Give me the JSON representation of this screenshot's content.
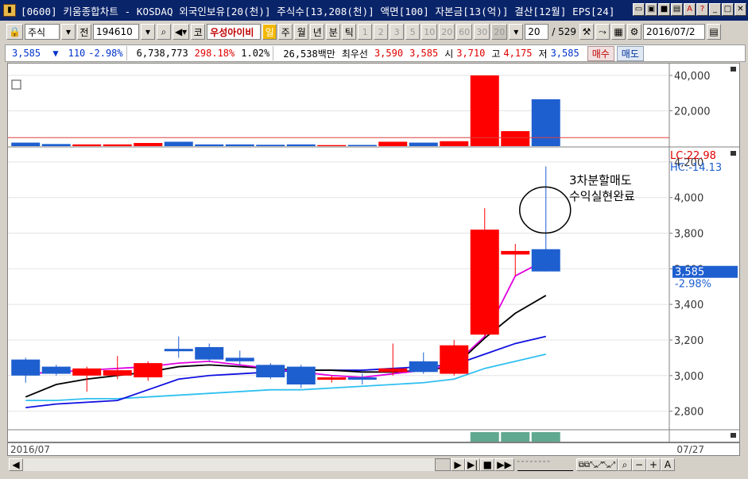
{
  "window": {
    "title": "[0600] 키움종합차트 - KOSDAQ 외국인보유[20(천)] 주식수[13,208(천)] 액면[100] 자본금[13(억)] 결산[12월] EPS[24]"
  },
  "toolbar": {
    "market": "주식",
    "prev": "전",
    "code": "194610",
    "name": "우성아이비",
    "period_buttons": [
      "일",
      "주",
      "월",
      "년",
      "분",
      "틱"
    ],
    "active_period": "일",
    "intervals": [
      "1",
      "2",
      "3",
      "5",
      "10",
      "20",
      "60",
      "30",
      "20"
    ],
    "count": "20",
    "total": "/ 529",
    "date": "2016/07/2"
  },
  "info": {
    "price": "3,585",
    "arrow": "▼",
    "change": "110",
    "change_pct": "-2.98%",
    "volume": "6,738,773",
    "volume_ratio": "298.18%",
    "turnover": "1.02%",
    "amount": "26,538백만",
    "best_ask_label": "최우선",
    "best_ask": "3,590",
    "best_bid": "3,585",
    "open_label": "시",
    "open": "3,710",
    "high_label": "고",
    "high": "4,175",
    "low_label": "저",
    "low": "3,585",
    "buy_label": "매수",
    "sell_label": "매도"
  },
  "volume_axis": [
    "40,000",
    "20,000"
  ],
  "price_axis": [
    "4,200",
    "4,000",
    "3,800",
    "3,600",
    "3,400",
    "3,200",
    "3,000",
    "2,800"
  ],
  "price_marker": {
    "value": "3,585",
    "pct": "-2.98%"
  },
  "lc_hc": {
    "lc": "LC:22.98",
    "hc": "HC:-14.13"
  },
  "annotation": {
    "line1": "3차분할매도",
    "line2": "수익실현완료"
  },
  "dates": {
    "start": "2016/07",
    "end": "07/27"
  },
  "chart_data": {
    "type": "candlestick",
    "ylim": [
      2700,
      4280
    ],
    "candles": [
      {
        "o": 3090,
        "c": 3000,
        "h": 3100,
        "l": 2960
      },
      {
        "o": 3050,
        "c": 3010,
        "h": 3060,
        "l": 3000
      },
      {
        "o": 3000,
        "c": 3040,
        "h": 3050,
        "l": 2910
      },
      {
        "o": 3000,
        "c": 3030,
        "h": 3110,
        "l": 2980
      },
      {
        "o": 2990,
        "c": 3070,
        "h": 3080,
        "l": 2970
      },
      {
        "o": 3150,
        "c": 3140,
        "h": 3220,
        "l": 3100
      },
      {
        "o": 3160,
        "c": 3090,
        "h": 3180,
        "l": 3080
      },
      {
        "o": 3100,
        "c": 3080,
        "h": 3140,
        "l": 3060
      },
      {
        "o": 3060,
        "c": 2990,
        "h": 3070,
        "l": 2980
      },
      {
        "o": 3050,
        "c": 2950,
        "h": 3060,
        "l": 2930
      },
      {
        "o": 2980,
        "c": 2990,
        "h": 3000,
        "l": 2960
      },
      {
        "o": 2990,
        "c": 2980,
        "h": 3010,
        "l": 2950
      },
      {
        "o": 3020,
        "c": 3040,
        "h": 3180,
        "l": 3000
      },
      {
        "o": 3080,
        "c": 3020,
        "h": 3130,
        "l": 3010
      },
      {
        "o": 3010,
        "c": 3170,
        "h": 3200,
        "l": 3000
      },
      {
        "o": 3230,
        "c": 3820,
        "h": 3940,
        "l": 3220
      },
      {
        "o": 3680,
        "c": 3700,
        "h": 3740,
        "l": 3560
      },
      {
        "o": 3710,
        "c": 3585,
        "h": 4175,
        "l": 3585
      }
    ],
    "ma_magenta": [
      3010,
      3020,
      3030,
      3040,
      3050,
      3070,
      3080,
      3060,
      3040,
      3020,
      3000,
      2990,
      3010,
      3030,
      3060,
      3220,
      3560,
      3650
    ],
    "ma_black": [
      2880,
      2950,
      2980,
      3000,
      3020,
      3050,
      3060,
      3050,
      3040,
      3030,
      3030,
      3020,
      3020,
      3030,
      3050,
      3210,
      3350,
      3450
    ],
    "ma_blue": [
      2820,
      2840,
      2850,
      2860,
      2920,
      2980,
      3000,
      3010,
      3020,
      3030,
      3030,
      3030,
      3040,
      3050,
      3060,
      3120,
      3180,
      3220
    ],
    "ma_cyan": [
      2860,
      2860,
      2870,
      2870,
      2880,
      2890,
      2900,
      2910,
      2920,
      2920,
      2930,
      2940,
      2950,
      2960,
      2980,
      3040,
      3080,
      3120
    ],
    "volume": [
      2000,
      1200,
      1000,
      1000,
      1800,
      2500,
      1000,
      1000,
      800,
      1000,
      600,
      700,
      2500,
      2000,
      2800,
      40000,
      8500,
      26500
    ],
    "volume_ylim": [
      0,
      44000
    ],
    "volume_ma": 4800
  },
  "colors": {
    "up": "#ff0000",
    "down": "#1e5fd0",
    "ma_magenta": "#e000e0",
    "ma_black": "#000000",
    "ma_blue": "#1010e0",
    "ma_cyan": "#30c0f0"
  }
}
